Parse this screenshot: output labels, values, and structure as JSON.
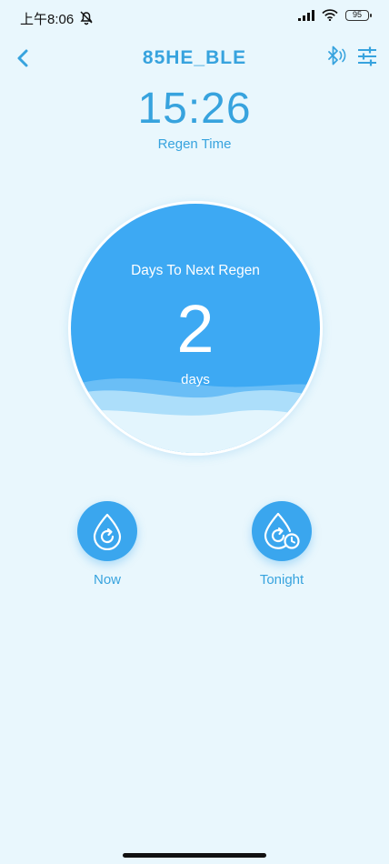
{
  "status_bar": {
    "time": "上午8:06",
    "battery": "95"
  },
  "header": {
    "title": "85HE_BLE"
  },
  "regen": {
    "time": "15:26",
    "label": "Regen Time"
  },
  "gauge": {
    "title": "Days To Next Regen",
    "value": "2",
    "unit": "days"
  },
  "actions": {
    "now_label": "Now",
    "tonight_label": "Tonight"
  },
  "icons": {
    "back": "chevron-left-icon",
    "bluetooth": "bluetooth-icon",
    "settings": "sliders-icon",
    "now": "water-drop-refresh-icon",
    "tonight": "water-drop-clock-icon"
  },
  "colors": {
    "accent": "#37a3de",
    "circle": "#3da9f3",
    "background": "#e9f7fd"
  }
}
